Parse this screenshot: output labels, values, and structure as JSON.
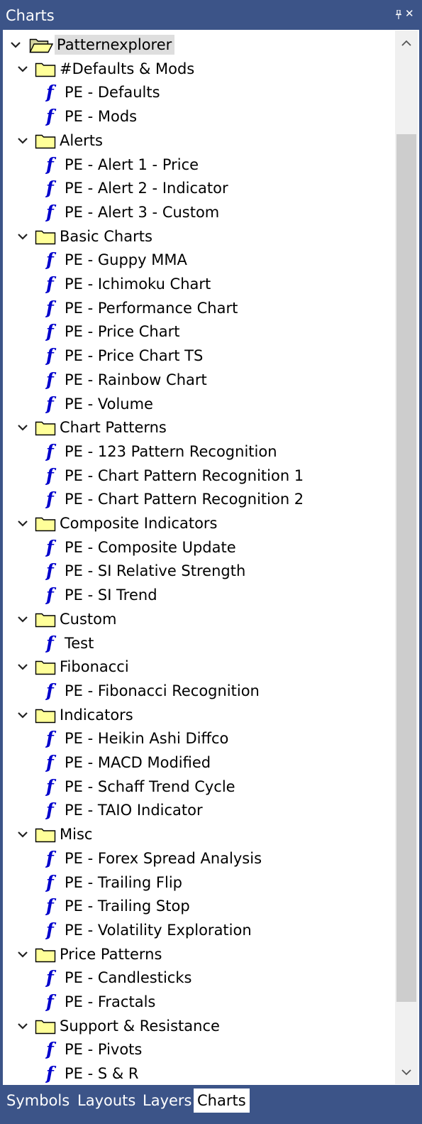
{
  "window": {
    "title": "Charts"
  },
  "tree": {
    "root_label": "Patternexplorer",
    "groups": [
      {
        "label": "#Defaults & Mods",
        "items": [
          "PE - Defaults",
          "PE - Mods"
        ]
      },
      {
        "label": "Alerts",
        "items": [
          "PE - Alert 1 - Price",
          "PE - Alert 2 - Indicator",
          "PE - Alert 3 - Custom"
        ]
      },
      {
        "label": "Basic Charts",
        "items": [
          "PE - Guppy MMA",
          "PE - Ichimoku Chart",
          "PE - Performance Chart",
          "PE - Price Chart",
          "PE - Price Chart TS",
          "PE - Rainbow Chart",
          "PE - Volume"
        ]
      },
      {
        "label": "Chart Patterns",
        "items": [
          "PE - 123 Pattern Recognition",
          "PE - Chart Pattern Recognition 1",
          "PE - Chart Pattern Recognition 2"
        ]
      },
      {
        "label": "Composite Indicators",
        "items": [
          "PE - Composite Update",
          "PE - SI Relative Strength",
          "PE - SI Trend"
        ]
      },
      {
        "label": "Custom",
        "items": [
          "Test"
        ]
      },
      {
        "label": "Fibonacci",
        "items": [
          "PE - Fibonacci Recognition"
        ]
      },
      {
        "label": "Indicators",
        "items": [
          "PE - Heikin Ashi Diffco",
          "PE - MACD Modified",
          "PE - Schaff Trend Cycle",
          "PE - TAIO Indicator"
        ]
      },
      {
        "label": "Misc",
        "items": [
          "PE - Forex Spread Analysis",
          "PE - Trailing Flip",
          "PE - Trailing Stop",
          "PE - Volatility Exploration"
        ]
      },
      {
        "label": "Price Patterns",
        "items": [
          "PE - Candlesticks",
          "PE - Fractals"
        ]
      },
      {
        "label": "Support & Resistance",
        "items": [
          "PE - Pivots",
          "PE - S & R"
        ]
      }
    ]
  },
  "icons": {
    "folder": "folder-icon",
    "folder_open": "folder-open-icon",
    "formula": "formula-icon",
    "expand": "chevron-down-icon"
  },
  "colors": {
    "title_bar": "#3c5488",
    "folder_fill": "#ffff99",
    "formula_icon": "#0000cc",
    "selection": "#dedede"
  },
  "tabs": [
    {
      "label": "Symbols",
      "active": false
    },
    {
      "label": "Layouts",
      "active": false
    },
    {
      "label": "Layers",
      "active": false
    },
    {
      "label": "Charts",
      "active": true
    }
  ]
}
